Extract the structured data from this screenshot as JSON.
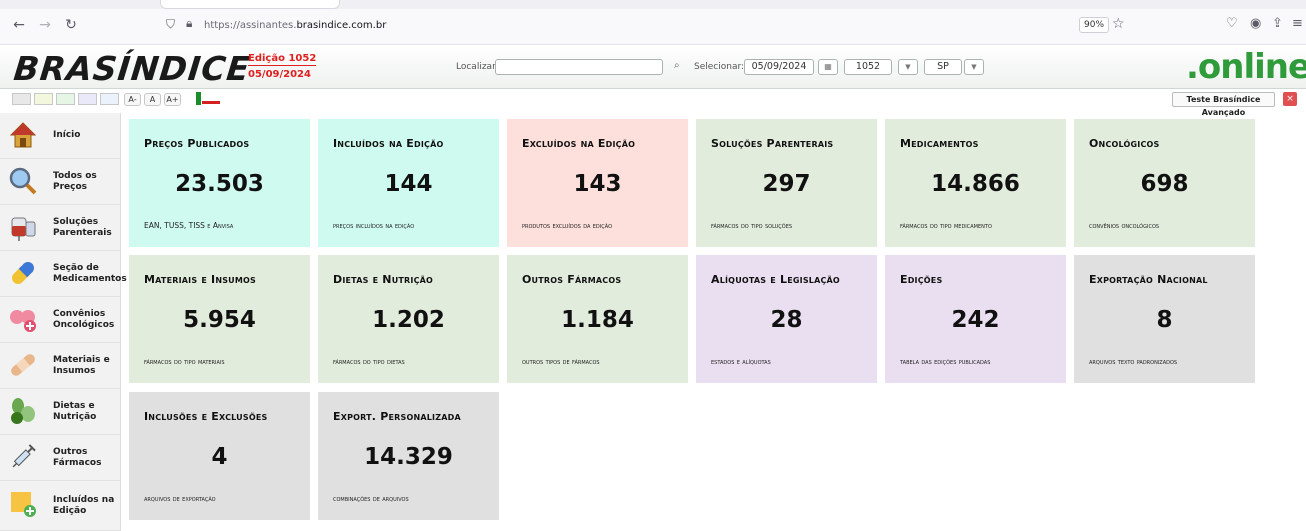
{
  "browser": {
    "url_prefix": "https://assinantes.",
    "url_domain": "brasindice.com.br",
    "zoom": "90%"
  },
  "header": {
    "logo": "BRASÍNDICE",
    "edition_label": "Edição 1052",
    "edition_date": "05/09/2024",
    "find_label": "Localizar:",
    "find_value": "",
    "select_label": "Selecionar:",
    "select_date": "05/09/2024",
    "select_edition": "1052",
    "select_state": "SP",
    "brand_suffix": ".online"
  },
  "toolbar": {
    "font_small": "A-",
    "font_normal": "A",
    "font_large": "A+",
    "teste_button": "Teste Brasíndice Avançado",
    "close": "×",
    "swatches": [
      "#e8e8e8",
      "#f3f7dc",
      "#e6f6e6",
      "#e9e9f9",
      "#ecf2fb"
    ]
  },
  "sidebar": {
    "items": [
      {
        "label": "Início",
        "icon": "home-icon"
      },
      {
        "label": "Todos os Preços",
        "icon": "magnifier-icon"
      },
      {
        "label": "Soluções Parenterais",
        "icon": "iv-bag-icon"
      },
      {
        "label": "Seção de Medicamentos",
        "icon": "capsule-icon"
      },
      {
        "label": "Convênios Oncológicos",
        "icon": "ribbon-icon"
      },
      {
        "label": "Materiais e Insumos",
        "icon": "bandage-icon"
      },
      {
        "label": "Dietas e Nutrição",
        "icon": "leaf-icon"
      },
      {
        "label": "Outros Fármacos",
        "icon": "syringe-icon"
      },
      {
        "label": "Incluídos na Edição",
        "icon": "add-note-icon"
      }
    ]
  },
  "tiles": [
    {
      "title": "Preços Publicados",
      "value": "23.503",
      "desc": "EAN, TUSS, TISS e Anvisa",
      "color": "cyan"
    },
    {
      "title": "Incluídos na Edição",
      "value": "144",
      "desc": "preços incluídos na edição",
      "color": "cyan"
    },
    {
      "title": "Excluídos na Edição",
      "value": "143",
      "desc": "produtos excluídos da edição",
      "color": "pink"
    },
    {
      "title": "Soluções Parenterais",
      "value": "297",
      "desc": "fármacos do tipo soluções",
      "color": "green"
    },
    {
      "title": "Medicamentos",
      "value": "14.866",
      "desc": "fármacos do tipo medicamento",
      "color": "green"
    },
    {
      "title": "Oncológicos",
      "value": "698",
      "desc": "convênios oncológicos",
      "color": "green"
    },
    {
      "title": "Materiais e Insumos",
      "value": "5.954",
      "desc": "fármacos do tipo materiais",
      "color": "green"
    },
    {
      "title": "Dietas e Nutrição",
      "value": "1.202",
      "desc": "fármacos do tipo dietas",
      "color": "green"
    },
    {
      "title": "Outros Fármacos",
      "value": "1.184",
      "desc": "outros tipos de fármacos",
      "color": "green"
    },
    {
      "title": "Alíquotas e Legislação",
      "value": "28",
      "desc": "estados e alíquotas",
      "color": "violet"
    },
    {
      "title": "Edições",
      "value": "242",
      "desc": "tabela das edições publicadas",
      "color": "violet"
    },
    {
      "title": "Exportação Nacional",
      "value": "8",
      "desc": "arquivos texto padronizados",
      "color": "grey"
    },
    {
      "title": "Inclusões e Exclusões",
      "value": "4",
      "desc": "arquivos de exportação",
      "color": "grey"
    },
    {
      "title": "Export. Personalizada",
      "value": "14.329",
      "desc": "combinações de arquivos",
      "color": "grey"
    }
  ]
}
